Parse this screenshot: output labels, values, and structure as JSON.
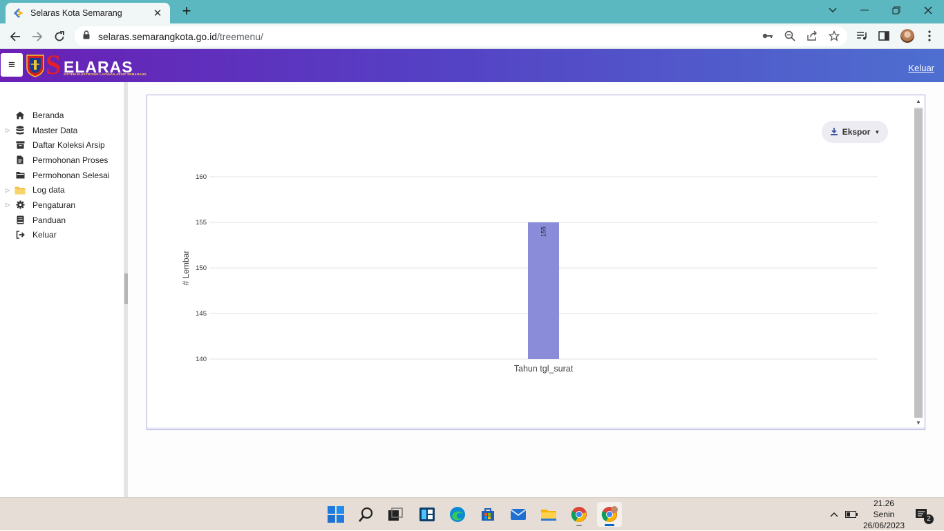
{
  "browser": {
    "tab_title": "Selaras Kota Semarang",
    "url_host": "selaras.semarangkota.go.id",
    "url_path": "/treemenu/"
  },
  "app": {
    "brand_initial": "S",
    "brand_rest": "ELARAS",
    "brand_subtitle": "SISTEM ELEKTRONIK LAYANAN ARSIP SEMARANG",
    "logout_label": "Keluar"
  },
  "sidebar": {
    "items": [
      {
        "label": "Beranda",
        "icon": "home-icon",
        "expandable": false
      },
      {
        "label": "Master Data",
        "icon": "database-icon",
        "expandable": true
      },
      {
        "label": "Daftar Koleksi Arsip",
        "icon": "archive-box-icon",
        "expandable": false
      },
      {
        "label": "Permohonan Proses",
        "icon": "document-icon",
        "expandable": false
      },
      {
        "label": "Permohonan Selesai",
        "icon": "folder-closed-icon",
        "expandable": false
      },
      {
        "label": "Log data",
        "icon": "folder-yellow-icon",
        "expandable": true
      },
      {
        "label": "Pengaturan",
        "icon": "gear-icon",
        "expandable": true
      },
      {
        "label": "Panduan",
        "icon": "book-icon",
        "expandable": false
      },
      {
        "label": "Keluar",
        "icon": "sign-out-icon",
        "expandable": false
      }
    ]
  },
  "export_button": {
    "label": "Ekspor"
  },
  "chart_data": {
    "type": "bar",
    "categories": [
      "Tahun tgl_surat"
    ],
    "values": [
      155
    ],
    "data_labels": [
      "155"
    ],
    "ylabel": "# Lembar",
    "xlabel": "",
    "ylim": [
      140,
      160
    ],
    "yticks": [
      140,
      145,
      150,
      155,
      160
    ],
    "grid": true,
    "bar_color": "#8b8cd9"
  },
  "taskbar": {
    "time": "21.26",
    "day": "Senin",
    "date": "26/06/2023",
    "notification_count": "2"
  },
  "colors": {
    "tabbar": "#5bb8c1",
    "header_start": "#6a1fb5",
    "header_end": "#4e6fd0",
    "brand_red": "#e0202a"
  }
}
